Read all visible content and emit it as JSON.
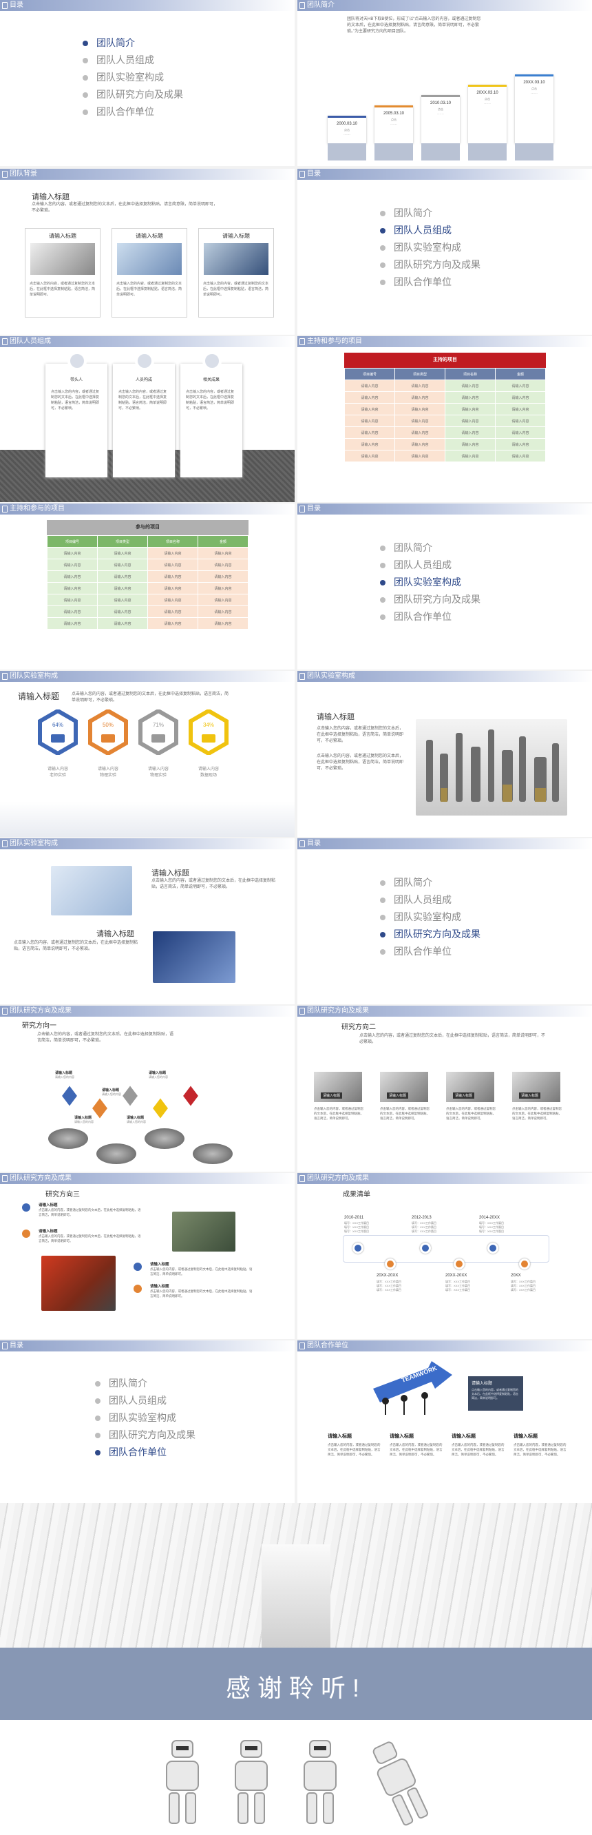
{
  "toc": [
    "团队简介",
    "团队人员组成",
    "团队实验室构成",
    "团队研究方向及成果",
    "团队合作单位"
  ],
  "headers": {
    "toc": "目录",
    "intro": "团队简介",
    "background": "团队背景",
    "members": "团队人员组成",
    "projects": "主持和参与的项目",
    "lab": "团队实验室构成",
    "research": "团队研究方向及成果",
    "partners": "团队合作单位"
  },
  "intro": {
    "text": "团队将对天HB下取B使位，形成了以“点击输入您的内容，或者通过复制您的文本后，在此框中选择复制粘贴，请言简意赅，简单说明即可，不必繁琐。”为主要研究方向的项目团队。",
    "steps": [
      {
        "date": "2000.03.10",
        "label": "点击",
        "dots": "……"
      },
      {
        "date": "2005.03.10",
        "label": "点击",
        "dots": "……"
      },
      {
        "date": "2010.03.10",
        "label": "点击",
        "dots": "……"
      },
      {
        "date": "20XX.03.10",
        "label": "点击",
        "dots": "……"
      },
      {
        "date": "20XX.03.10",
        "label": "点击",
        "dots": "……"
      }
    ],
    "colors": [
      "#3b5ba8",
      "#e38b2f",
      "#9d9d9d",
      "#f0c419",
      "#3b7fd0"
    ]
  },
  "background": {
    "title": "请输入标题",
    "text": "点击输入您的内容，或者通过复制您的文本后，在此框中选择复制粘贴，请言简意赅，简单说明即可，不必繁琐。",
    "cards": [
      {
        "title": "请输入标题",
        "text": "点击输入您的内容，或者通过复制您的文本后，在此框中选择复制粘贴，语言简洁，简单说明即可。"
      },
      {
        "title": "请输入标题",
        "text": "点击输入您的内容，或者通过复制您的文本后，在此框中选择复制粘贴，语言简洁，简单说明即可。"
      },
      {
        "title": "请输入标题",
        "text": "点击输入您的内容，或者通过复制您的文本后，在此框中选择复制粘贴，语言简洁，简单说明即可。"
      }
    ]
  },
  "members": {
    "roles": [
      "带头人",
      "人员构成",
      "相关成果"
    ],
    "text": "点击输入您的内容，或者通过复制您的文本后，在此框中选择复制粘贴，语言简洁，简单说明即可，不必繁琐。"
  },
  "projects": {
    "title": "主持的项目",
    "title2": "参与的项目",
    "cols": [
      "项目编号",
      "项目类型",
      "项目名称",
      "金额"
    ],
    "cell": "请输入内容",
    "rows": 7
  },
  "lab1": {
    "title": "请输入标题",
    "text": "点击输入您的内容，或者通过复制您的文本后，在此框中选择复制粘贴，语言简洁，简单说明即可，不必繁琐。",
    "items": [
      {
        "pct": "64%",
        "label": "请输入内容",
        "sub": "老师实验"
      },
      {
        "pct": "50%",
        "label": "请输入内容",
        "sub": "物理实验"
      },
      {
        "pct": "71%",
        "label": "请输入内容",
        "sub": "物理实验"
      },
      {
        "pct": "34%",
        "label": "请输入内容",
        "sub": "数据现场"
      }
    ]
  },
  "lab2": {
    "title": "请输入标题",
    "text1": "点击输入您的内容，或者通过复制您的文本后，在此框中选择复制粘贴，语言简洁，简单说明即可，不必繁琐。",
    "text2": "点击输入您的内容，或者通过复制您的文本后，在此框中选择复制粘贴，语言简洁，简单说明即可，不必繁琐。"
  },
  "lab3": {
    "title1": "请输入标题",
    "text1": "点击输入您的内容，或者通过复制您的文本后，在此框中选择复制粘贴，语言简洁，简单说明即可，不必繁琐。",
    "title2": "请输入标题",
    "text2": "点击输入您的内容，或者通过复制您的文本后，在此框中选择复制粘贴，语言简洁，简单说明即可，不必繁琐。"
  },
  "research1": {
    "title": "研究方向一",
    "text": "点击输入您的内容，或者通过复制您的文本后，在此框中选择复制粘贴，语言简洁，简单说明即可，不必繁琐。",
    "label": "请输入标题",
    "sub": "请输入您的内容"
  },
  "research2": {
    "title": "研究方向二",
    "text": "点击输入您的内容，或者通过复制您的文本后，在此框中选择复制粘贴，语言简洁，简单说明即可，不必繁琐。",
    "cardLabel": "请输入标题",
    "cardText": "点击输入您的内容，或者通过复制您的文本后，在此框中选择复制粘贴，语言简洁，简单说明即可。"
  },
  "research3": {
    "title": "研究方向三",
    "label": "请输入标题",
    "text": "点击输入您的内容，或者通过复制您的文本后，在此框中选择复制粘贴，语言简洁，简单说明即可。"
  },
  "results": {
    "title": "成果清单",
    "top": [
      "2010-2011",
      "2012-2013",
      "2014-20XX"
    ],
    "bottom": [
      "20XX-20XX",
      "20XX-20XX",
      "20XX"
    ],
    "lines": [
      "填写：XXX工作篇目",
      "填写：XXX工作篇目",
      "填写：XXX工作篇目"
    ]
  },
  "partners": {
    "teamwork": "TEAMWORK",
    "boxTitle": "请输入标题",
    "boxText": "点击输入您的内容，或者通过复制您的文本后，在此框中选择复制粘贴，语言简洁，简单说明即可。",
    "cols": [
      {
        "title": "请输入标题",
        "text": "点击输入您的内容，或者通过复制您的文本后，在此框中选择复制粘贴，语言简洁，简单说明即可，不必繁琐。"
      },
      {
        "title": "请输入标题",
        "text": "点击输入您的内容，或者通过复制您的文本后，在此框中选择复制粘贴，语言简洁，简单说明即可，不必繁琐。"
      },
      {
        "title": "请输入标题",
        "text": "点击输入您的内容，或者通过复制您的文本后，在此框中选择复制粘贴，语言简洁，简单说明即可，不必繁琐。"
      },
      {
        "title": "请输入标题",
        "text": "点击输入您的内容，或者通过复制您的文本后，在此框中选择复制粘贴，语言简洁，简单说明即可，不必繁琐。"
      }
    ]
  },
  "thanks": "感谢聆听!"
}
